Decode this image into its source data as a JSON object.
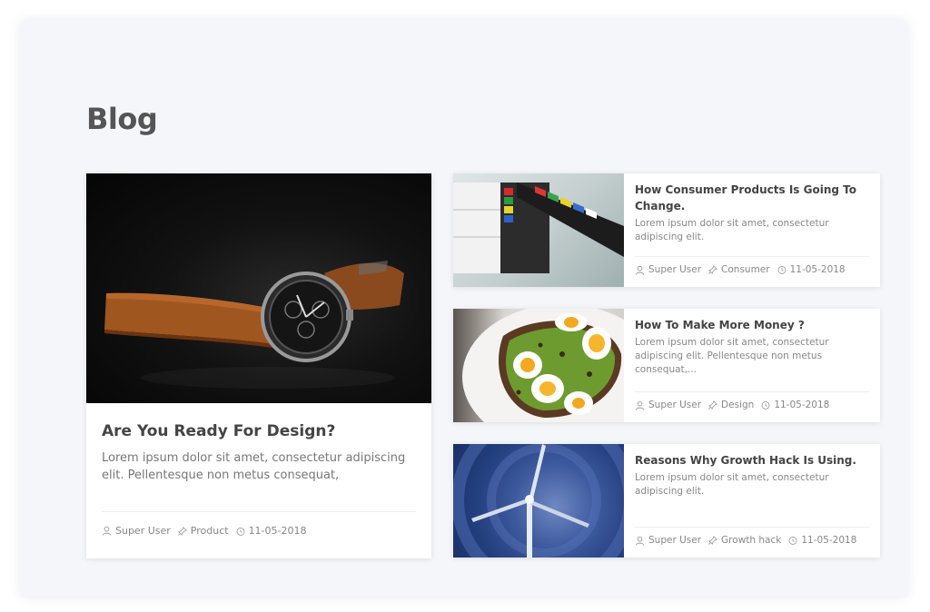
{
  "page": {
    "title": "Blog"
  },
  "featured": {
    "title": "Are You Ready For Design?",
    "excerpt": "Lorem ipsum dolor sit amet, consectetur adipiscing elit. Pellentesque non metus consequat,",
    "author": "Super User",
    "category": "Product",
    "date": "11-05-2018",
    "image": "watch-photo"
  },
  "posts": [
    {
      "title": "How Consumer Products Is Going To Change.",
      "excerpt": "Lorem ipsum dolor sit amet, consectetur adipiscing elit.",
      "author": "Super User",
      "category": "Consumer",
      "date": "11-05-2018",
      "image": "clapperboard-photo"
    },
    {
      "title": "How To Make More Money ?",
      "excerpt": "Lorem ipsum dolor sit amet, consectetur adipiscing elit. Pellentesque non metus consequat,...",
      "author": "Super User",
      "category": "Design",
      "date": "11-05-2018",
      "image": "avocado-toast-photo"
    },
    {
      "title": "Reasons Why Growth Hack Is Using.",
      "excerpt": "Lorem ipsum dolor sit amet, consectetur adipiscing elit.",
      "author": "Super User",
      "category": "Growth hack",
      "date": "11-05-2018",
      "image": "wind-turbine-photo"
    }
  ],
  "icons": {
    "author": "user-icon",
    "category": "pin-icon",
    "date": "clock-icon"
  },
  "colors": {
    "background": "#f5f6f9",
    "card": "#ffffff",
    "title": "#444444",
    "text": "#888888"
  }
}
